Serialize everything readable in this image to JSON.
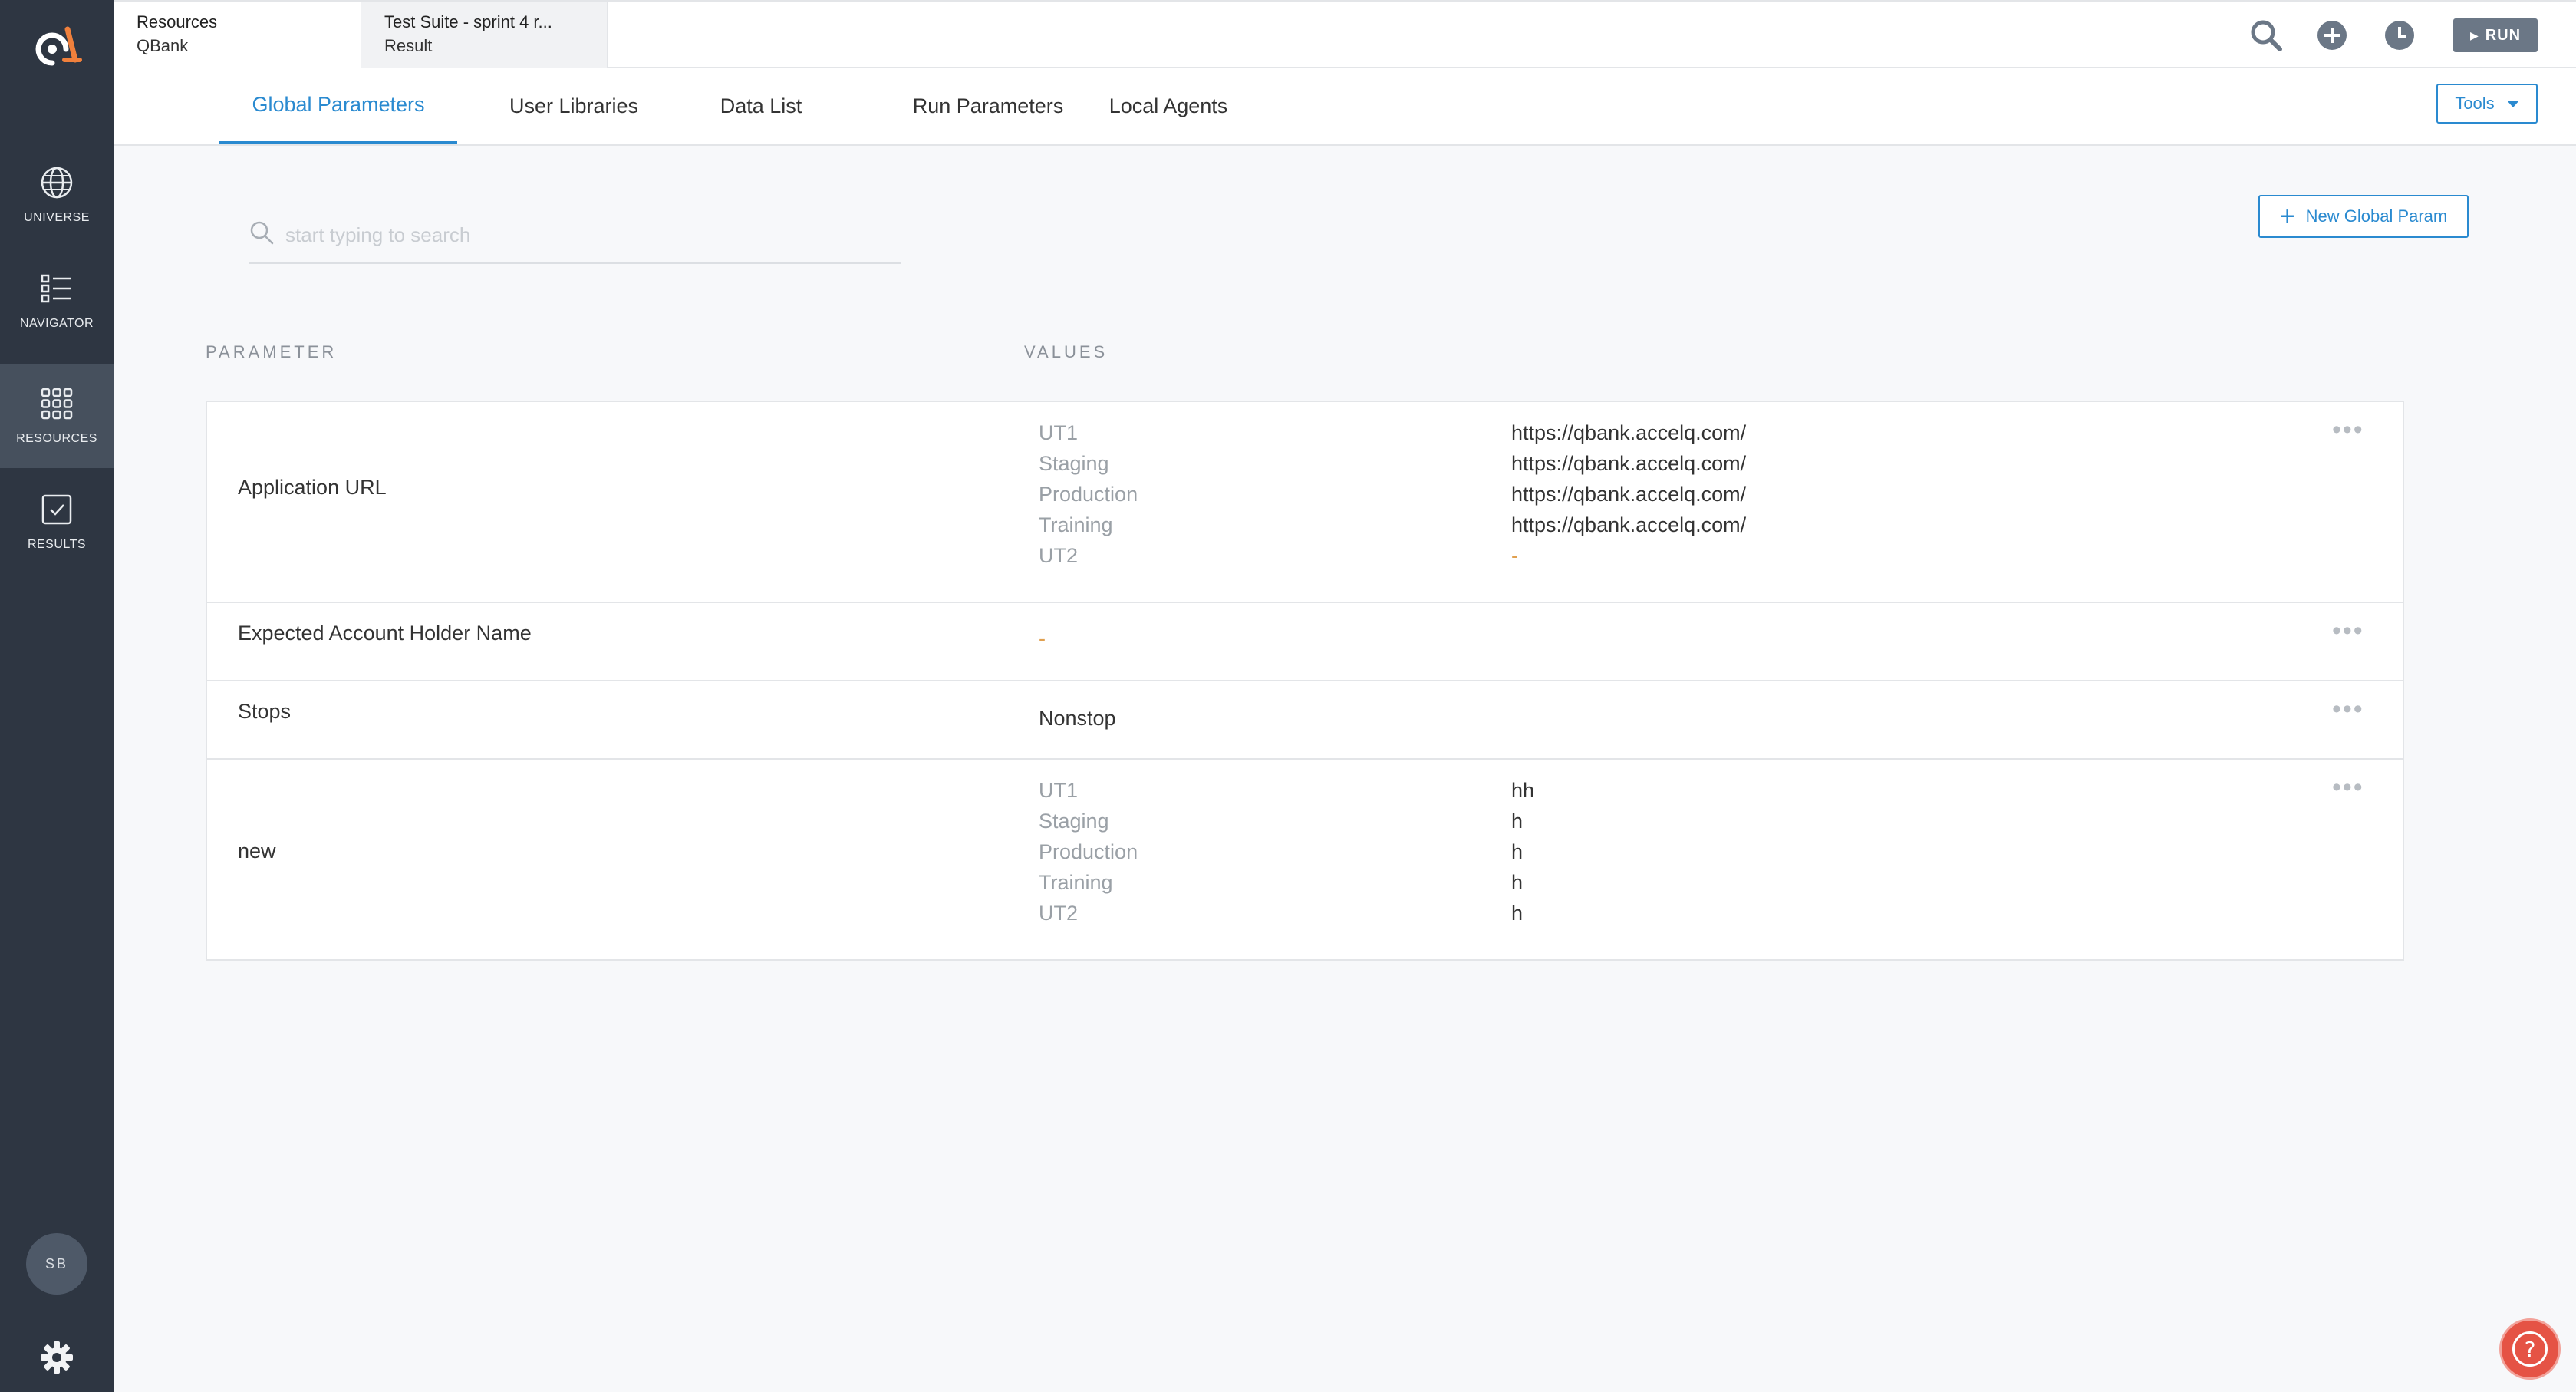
{
  "sidebar": {
    "logo": "accelq-logo",
    "items": [
      {
        "label": "UNIVERSE",
        "icon": "globe-icon"
      },
      {
        "label": "NAVIGATOR",
        "icon": "list-icon"
      },
      {
        "label": "RESOURCES",
        "icon": "grid-icon"
      },
      {
        "label": "RESULTS",
        "icon": "checkbox-icon"
      }
    ],
    "avatar": "SB",
    "settings_icon": "gear-icon"
  },
  "context_tabs": [
    {
      "title": "Resources",
      "subtitle": "QBank"
    },
    {
      "title": "Test Suite - sprint 4 r...",
      "subtitle": "Result"
    }
  ],
  "topbar": {
    "icons": [
      "search-icon",
      "add-circle-icon",
      "clock-icon"
    ],
    "run_label": "RUN"
  },
  "subtabs": [
    "Global Parameters",
    "User Libraries",
    "Data List",
    "Run Parameters",
    "Local Agents"
  ],
  "active_subtab": "Global Parameters",
  "tools_label": "Tools",
  "search": {
    "placeholder": "start typing to search",
    "value": ""
  },
  "new_button_label": "New Global Param",
  "columns": {
    "parameter": "PARAMETER",
    "values": "VALUES"
  },
  "parameters": [
    {
      "name": "Application URL",
      "envs": [
        "UT1",
        "Staging",
        "Production",
        "Training",
        "UT2"
      ],
      "values": [
        "https://qbank.accelq.com/",
        "https://qbank.accelq.com/",
        "https://qbank.accelq.com/",
        "https://qbank.accelq.com/",
        "-"
      ]
    },
    {
      "name": "Expected Account Holder Name",
      "single": "-"
    },
    {
      "name": "Stops",
      "single": "Nonstop"
    },
    {
      "name": "new",
      "envs": [
        "UT1",
        "Staging",
        "Production",
        "Training",
        "UT2"
      ],
      "values": [
        "hh",
        "h",
        "h",
        "h",
        "h"
      ]
    }
  ],
  "row_menu_label": "•••",
  "help_label": "?",
  "colors": {
    "accent": "#2a8ad0",
    "sidebar": "#2e3642",
    "help": "#e55345"
  }
}
